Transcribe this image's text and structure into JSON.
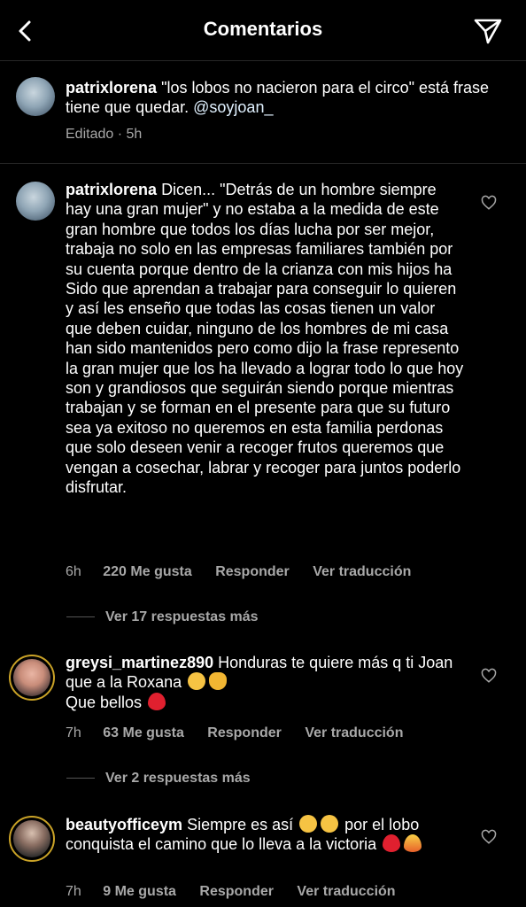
{
  "header": {
    "title": "Comentarios"
  },
  "caption": {
    "username": "patrixlorena",
    "text": "\"los lobos no nacieron para el circo\" está frase tiene que quedar.",
    "mention": "@soyjoan_",
    "edited": "Editado",
    "time": "5h"
  },
  "comments": [
    {
      "username": "patrixlorena",
      "text": "Dicen... \"Detrás de un hombre siempre hay una gran mujer\" y no estaba a la medida de este gran hombre que todos los días lucha por ser mejor, trabaja no solo en las empresas familiares también por su cuenta porque dentro de la crianza con mis hijos ha Sido que aprendan a trabajar para conseguir lo quieren y así les enseño que todas las cosas tienen un valor  que deben cuidar, ninguno de los hombres de mi casa han sido mantenidos pero como dijo la frase represento la gran mujer que los ha llevado a lograr todo lo que hoy son y grandiosos que seguirán siendo porque mientras  trabajan y se forman en el presente  para que su futuro sea ya exitoso no queremos en esta familia perdonas que solo deseen venir a recoger frutos queremos que vengan a cosechar, labrar y recoger para juntos poderlo disfrutar.",
      "time": "6h",
      "likes": "220 Me gusta",
      "reply": "Responder",
      "translate": "Ver traducción",
      "more_replies": "Ver 17 respuestas más"
    },
    {
      "username": "greysi_martinez890",
      "text": "Honduras te quiere más q ti Joan que a la Roxana",
      "text2": "Que bellos",
      "time": "7h",
      "likes": "63 Me gusta",
      "reply": "Responder",
      "translate": "Ver traducción",
      "more_replies": "Ver 2 respuestas más"
    },
    {
      "username": "beautyofficeym",
      "text": "Siempre es así",
      "text_b": "por el lobo conquista el camino que lo lleva a la victoria",
      "time": "7h",
      "likes": "9 Me gusta",
      "reply": "Responder",
      "translate": "Ver traducción"
    }
  ],
  "icons": {
    "back": "chevron-left-icon",
    "send": "paper-plane-icon",
    "heart": "heart-outline-icon",
    "emoji_laugh": "tears-of-joy-emoji",
    "emoji_clap": "clapping-hands-emoji",
    "emoji_heart": "red-heart-emoji",
    "emoji_hearteyes": "heart-eyes-emoji",
    "emoji_fire": "fire-emoji"
  }
}
